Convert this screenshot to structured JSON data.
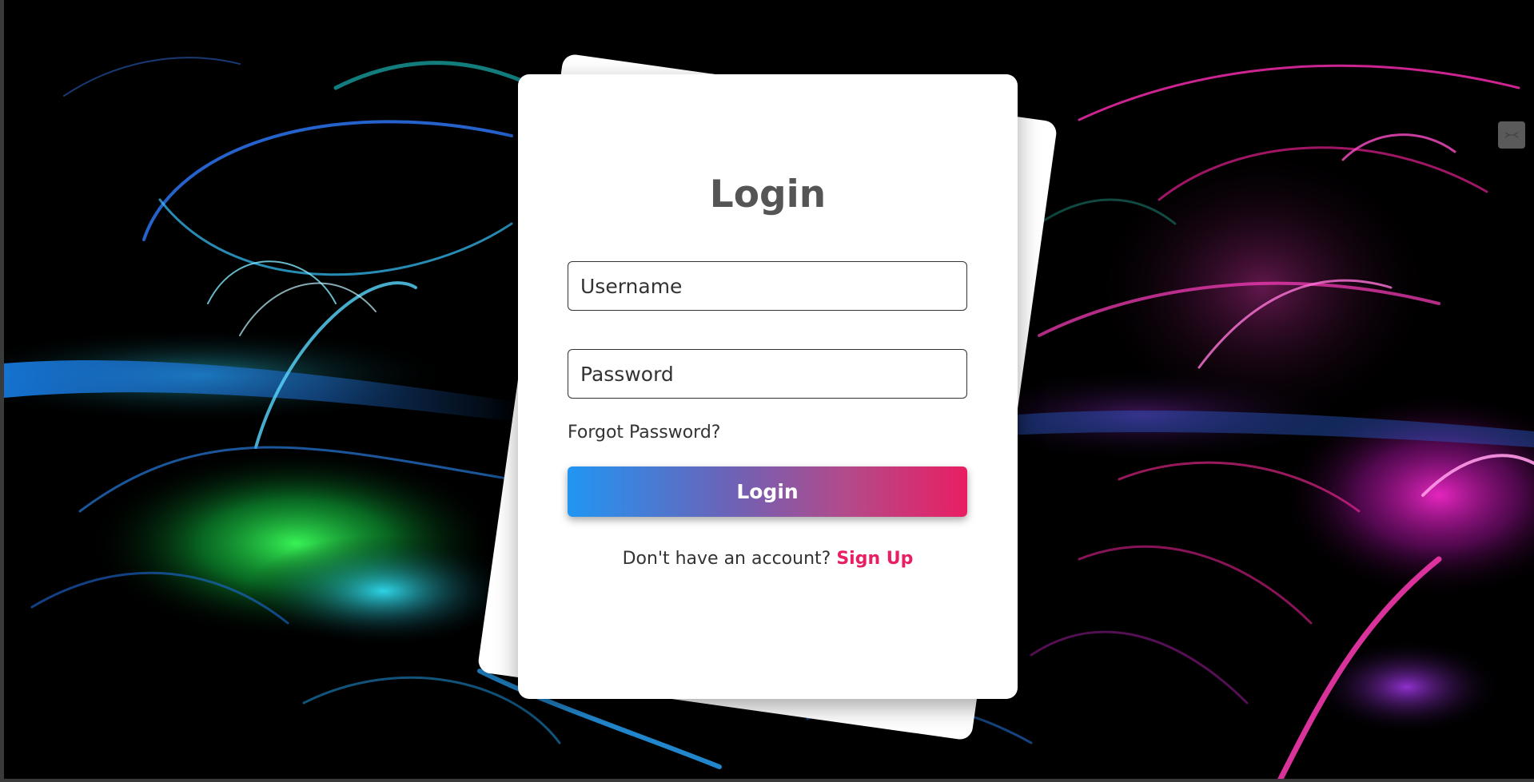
{
  "login_card": {
    "title": "Login",
    "username_placeholder": "Username",
    "password_placeholder": "Password",
    "forgot_password": "Forgot Password?",
    "submit_label": "Login",
    "signup_prompt": "Don't have an account?",
    "signup_link": "Sign Up"
  },
  "colors": {
    "title_text": "#555555",
    "button_gradient_start": "#2196f3",
    "button_gradient_end": "#e91e63",
    "signup_link": "#e91e63",
    "card_background": "#ffffff"
  },
  "icons": {
    "corner_widget": "collapse-arrows-icon"
  }
}
